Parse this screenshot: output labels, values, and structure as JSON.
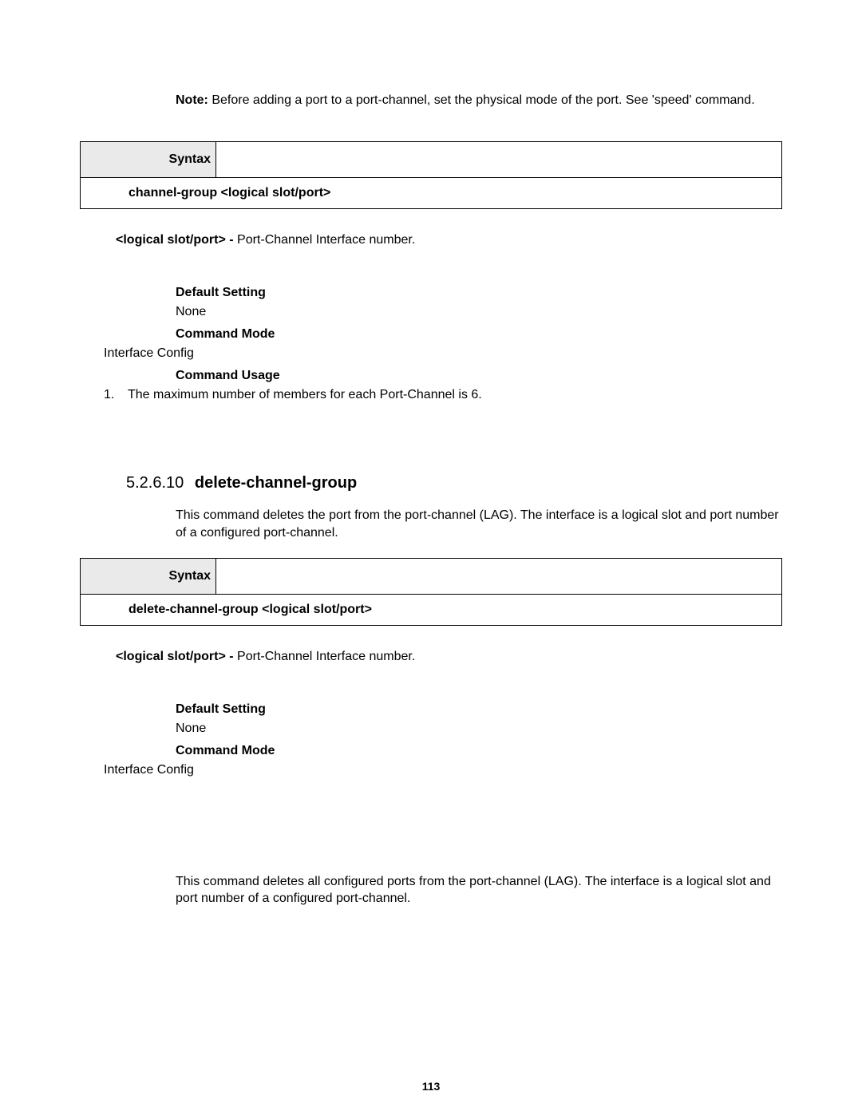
{
  "note": {
    "label": "Note:",
    "text": " Before adding a port to a port-channel, set the physical mode of the port. See 'speed' command."
  },
  "section1": {
    "syntax_label": "Syntax",
    "syntax_body": "channel-group <logical slot/port>",
    "param_name": "<logical slot/port> - ",
    "param_desc": "Port-Channel Interface number.",
    "default_label": "Default Setting",
    "default_value": "None",
    "mode_label": "Command Mode",
    "mode_value": "Interface Config",
    "usage_label": "Command Usage",
    "usage_num": "1.",
    "usage_text": "The maximum number of members for each Port-Channel is 6."
  },
  "section2": {
    "number": "5.2.6.10",
    "title": "delete-channel-group",
    "desc": "This command deletes the port from the port-channel (LAG). The interface is a logical slot and port number of a configured port-channel.",
    "syntax_label": "Syntax",
    "syntax_body": "delete-channel-group <logical slot/port>",
    "param_name": "<logical slot/port> - ",
    "param_desc": "Port-Channel Interface number.",
    "default_label": "Default Setting",
    "default_value": "None",
    "mode_label": "Command Mode",
    "mode_value": "Interface Config",
    "closing": "This command deletes all configured ports from the port-channel (LAG). The interface is a logical slot and port number of a configured port-channel."
  },
  "page_number": "113"
}
